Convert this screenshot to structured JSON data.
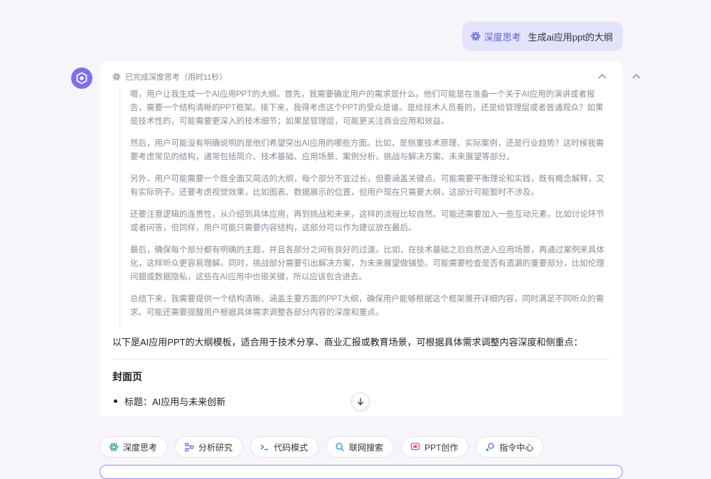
{
  "user_message": {
    "mode_tag": "深度思考",
    "text": "生成ai应用ppt的大纲"
  },
  "thinking": {
    "status": "已完成深度思考（用时11秒）",
    "paragraphs": [
      "嗯，用户让我生成一个AI应用PPT的大纲。首先，我需要确定用户的需求是什么。他们可能是在准备一个关于AI应用的演讲或者报告，需要一个结构清晰的PPT框架。接下来，我得考虑这个PPT的受众是谁。是给技术人员看的，还是给管理层或者普通观众？如果是技术性的，可能需要更深入的技术细节；如果是管理层，可能更关注商业应用和效益。",
      "然后，用户可能没有明确说明的是他们希望突出AI应用的哪些方面。比如，是侧重技术原理、实际案例，还是行业趋势？这时候我需要考虑常见的结构，通常包括简介、技术基础、应用场景、案例分析、挑战与解决方案、未来展望等部分。",
      "另外，用户可能需要一个既全面又简洁的大纲，每个部分不宜过长，但要涵盖关键点。可能需要平衡理论和实践，既有概念解释，又有实际例子。还要考虑视觉效果，比如图表、数据展示的位置，但用户现在只需要大纲，这部分可能暂时不涉及。",
      "还要注意逻辑的连贯性，从介绍到具体应用，再到挑战和未来，这样的流程比较自然。可能还需要加入一些互动元素，比如讨论环节或者问答，但同样，用户可能只需要内容结构，这部分可以作为建议放在最后。",
      "最后，确保每个部分都有明确的主题，并且各部分之间有良好的过渡。比如，在技术基础之后自然进入应用场景，再通过案例来具体化，这样听众更容易理解。同时，挑战部分需要引出解决方案，为未来展望做铺垫。可能需要检查是否有遗漏的重要部分，比如伦理问题或数据隐私，这些在AI应用中也很关键，所以应该包含进去。",
      "总结下来，我需要提供一个结构清晰、涵盖主要方面的PPT大纲，确保用户能够根据这个框架展开详细内容，同时满足不同听众的需求。可能还需要提醒用户根据具体需求调整各部分内容的深度和重点。"
    ]
  },
  "answer": {
    "intro": "以下是AI应用PPT的大纲模板，适合用于技术分享、商业汇报或教育场景，可根据具体需求调整内容深度和侧重点：",
    "section_title": "封面页",
    "bullet_1": "标题：AI应用与未来创新"
  },
  "toolbar": {
    "chips": [
      "深度思考",
      "分析研究",
      "代码模式",
      "联网搜索",
      "PPT创作",
      "指令中心"
    ]
  },
  "icons": {
    "avatar": "assistant-logo-icon",
    "think": "atom-icon",
    "collapse": "chevron-up-icon",
    "scroll": "arrow-down-icon"
  },
  "colors": {
    "accent": "#5b5fd6",
    "avatar": "#7b6ff0",
    "user_bubble": "#e3e4fb",
    "think_text": "#8a8a96"
  }
}
